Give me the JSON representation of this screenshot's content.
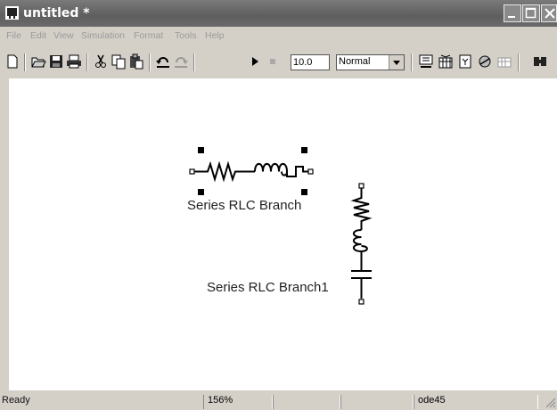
{
  "window": {
    "title": "untitled *"
  },
  "menu": [
    "File",
    "Edit",
    "View",
    "Simulation",
    "Format",
    "Tools",
    "Help"
  ],
  "toolbar": {
    "icons": [
      "new-icon",
      "open-icon",
      "save-icon",
      "print-icon",
      "cut-icon",
      "copy-icon",
      "paste-icon",
      "undo-icon",
      "redo-icon",
      "play-icon",
      "stop-icon",
      "build-icon",
      "library-icon",
      "debug-icon",
      "explorer-icon",
      "model-icon",
      "extra-icon"
    ],
    "stop_time": "10.0",
    "mode": "Normal"
  },
  "canvas": {
    "blocks": [
      {
        "label": "Series RLC Branch"
      },
      {
        "label": "Series RLC Branch1"
      }
    ]
  },
  "status": {
    "left": "Ready",
    "zoom": "156%",
    "solver": "ode45"
  }
}
